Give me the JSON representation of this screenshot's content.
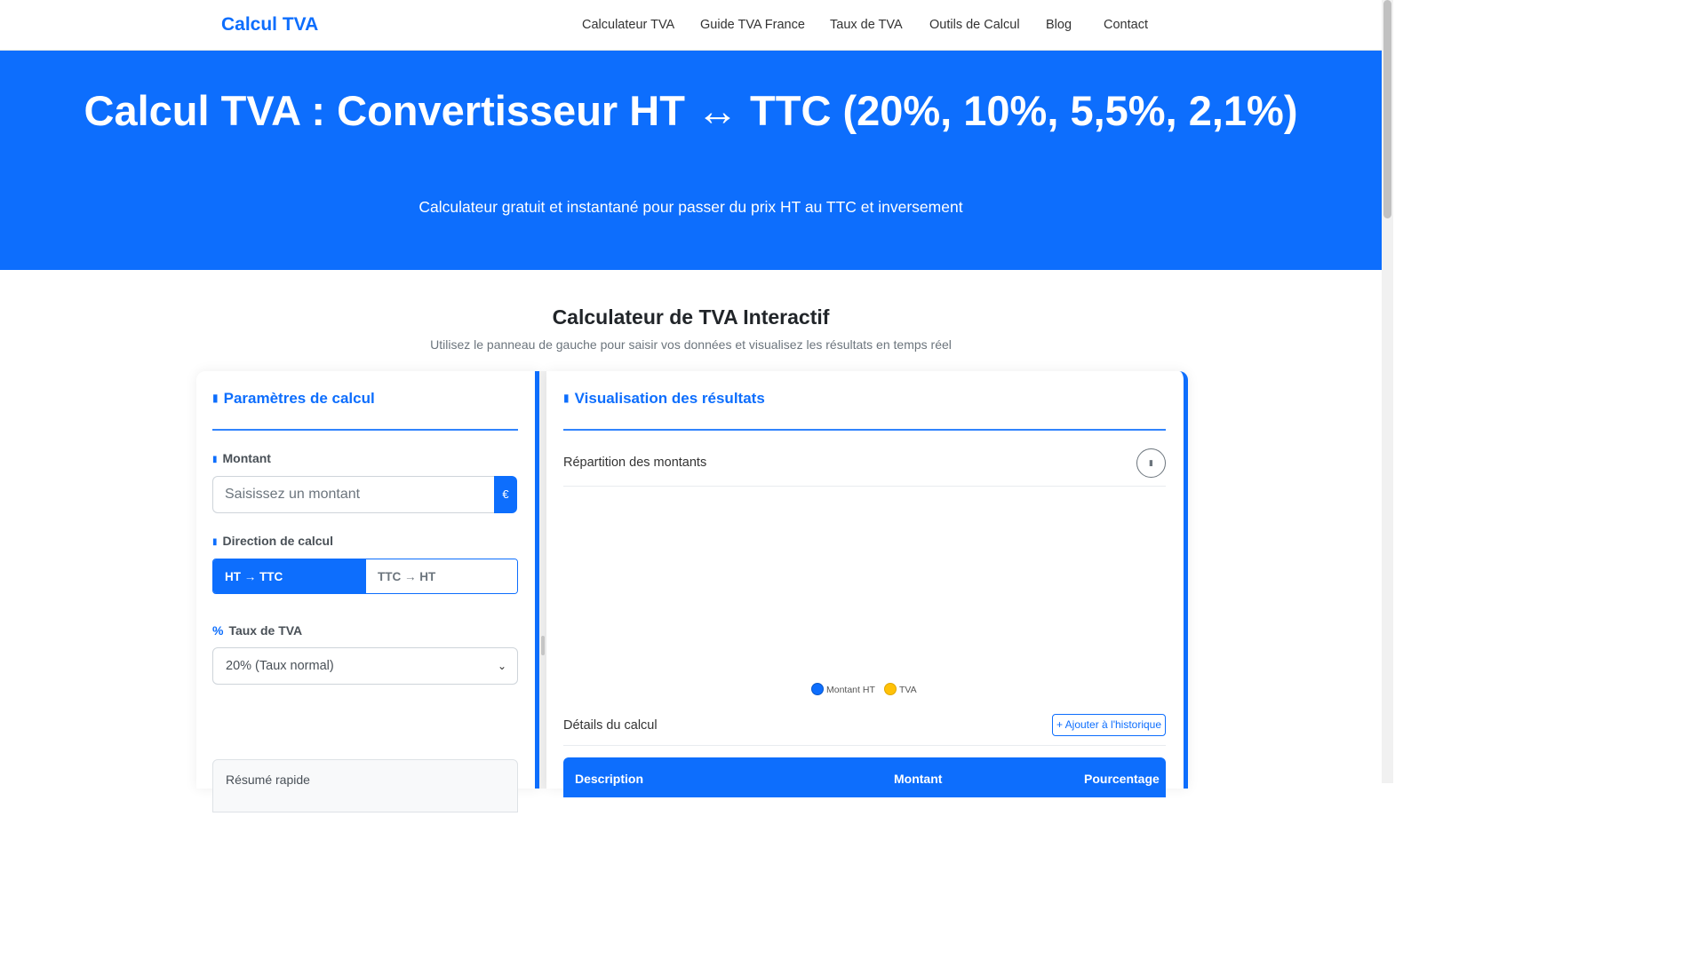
{
  "nav": {
    "brand": "Calcul TVA",
    "links": [
      "Calculateur TVA",
      "Guide TVA France",
      "Taux de TVA",
      "Outils de Calcul",
      "Blog",
      "Contact"
    ]
  },
  "hero": {
    "title": "Calcul TVA : Convertisseur HT ↔ TTC (20%, 10%, 5,5%, 2,1%)",
    "subtitle": "Calculateur gratuit et instantané pour passer du prix HT au TTC et inversement"
  },
  "section": {
    "title": "Calculateur de TVA Interactif",
    "subtitle": "Utilisez le panneau de gauche pour saisir vos données et visualisez les résultats en temps réel"
  },
  "params": {
    "heading": "Paramètres de calcul",
    "amount_label": "Montant",
    "amount_placeholder": "Saisissez un montant",
    "currency": "€",
    "direction_label": "Direction de calcul",
    "direction_options": [
      "HT → TTC",
      "TTC → HT"
    ],
    "direction_selected": "HT → TTC",
    "rate_label": "Taux de TVA",
    "rate_icon_text": "%",
    "rate_selected": "20% (Taux normal)",
    "summary_title": "Résumé rapide"
  },
  "results": {
    "heading": "Visualisation des résultats",
    "chart_title": "Répartition des montants",
    "legend": [
      {
        "name": "Montant HT",
        "color": "#0d6efd"
      },
      {
        "name": "TVA",
        "color": "#ffc107"
      }
    ],
    "details_title": "Détails du calcul",
    "history_button": "+ Ajouter à l'historique",
    "table_headers": [
      "Description",
      "Montant",
      "Pourcentage"
    ]
  },
  "colors": {
    "primary": "#0d6efd",
    "accent": "#ffc107"
  }
}
